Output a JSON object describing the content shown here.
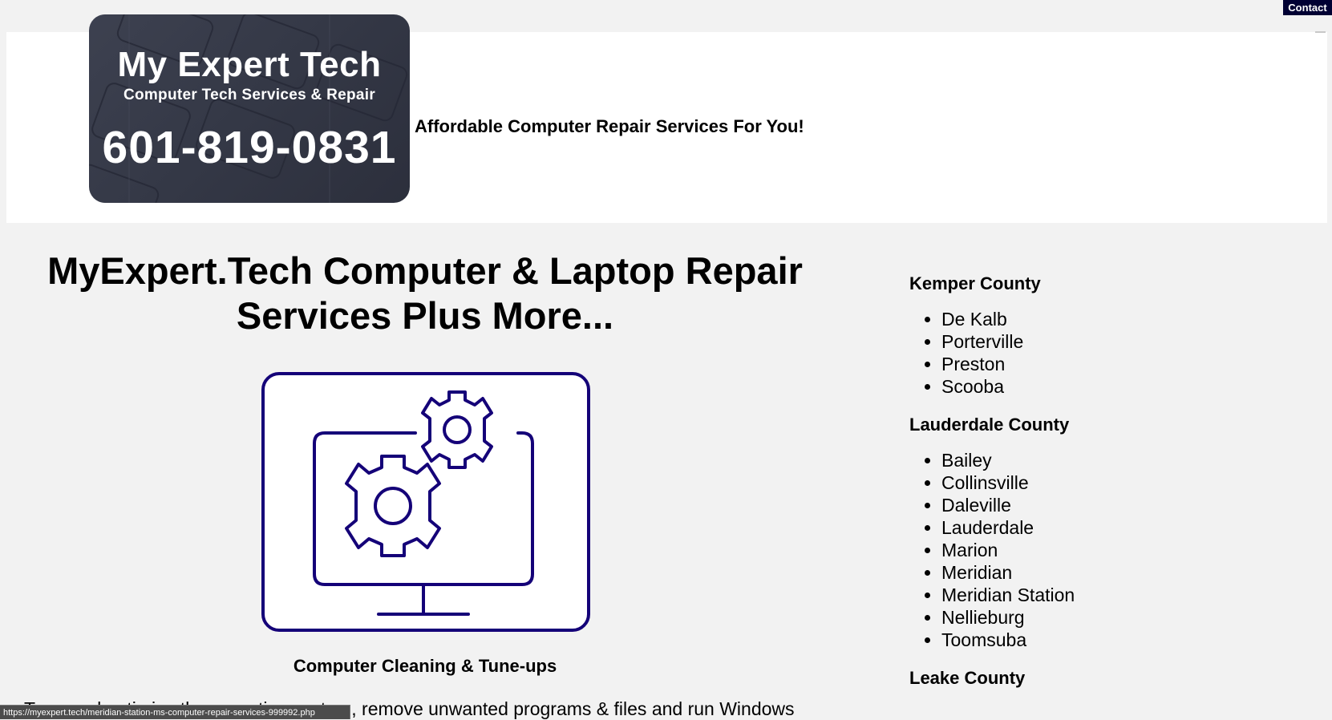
{
  "topbar": {
    "contact_label": "Contact"
  },
  "header": {
    "logo": {
      "title": "My Expert Tech",
      "subtitle": "Computer Tech Services & Repair",
      "phone": "601-819-0831"
    },
    "tagline": "Affordable Computer Repair Services For You!"
  },
  "main": {
    "headline": "MyExpert.Tech Computer & Laptop Repair Services Plus More...",
    "service": {
      "image_icon": "monitor-gears-icon",
      "accent_color": "#140078",
      "title": "Computer Cleaning & Tune-ups",
      "description": "Tune and optimize the operating system, remove unwanted programs & files and run Windows"
    }
  },
  "sidebar": {
    "counties": [
      {
        "name": "Kemper County",
        "towns": [
          "De Kalb",
          "Porterville",
          "Preston",
          "Scooba"
        ]
      },
      {
        "name": "Lauderdale County",
        "towns": [
          "Bailey",
          "Collinsville",
          "Daleville",
          "Lauderdale",
          "Marion",
          "Meridian",
          "Meridian Station",
          "Nellieburg",
          "Toomsuba"
        ]
      },
      {
        "name": "Leake County",
        "towns": []
      }
    ]
  },
  "status_bar": {
    "url": "https://myexpert.tech/meridian-station-ms-computer-repair-services-999992.php"
  }
}
